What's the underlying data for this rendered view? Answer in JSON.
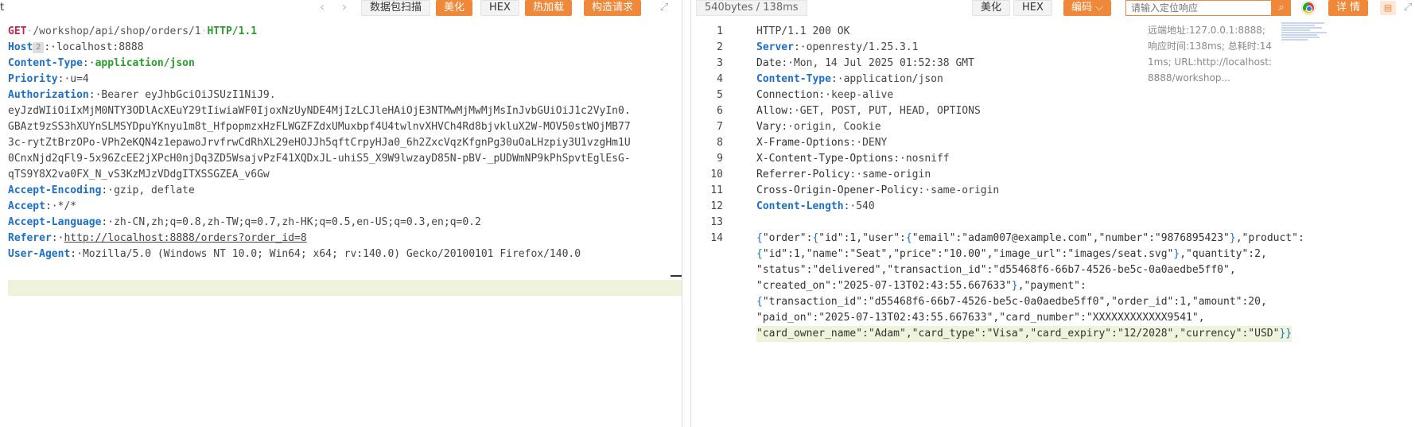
{
  "left_toolbar": {
    "title": "t",
    "back_arrow": "‹",
    "forward_arrow": "›",
    "buttons": {
      "scan": "数据包扫描",
      "beautify": "美化",
      "hex": "HEX",
      "hot_load": "热加载",
      "build_request": "构造请求"
    },
    "expand_glyph": "⤢"
  },
  "request": {
    "method": "GET",
    "path": "/workshop/api/shop/orders/1",
    "protocol": "HTTP/1.1",
    "host_key": "Host",
    "host_badge": "2",
    "host_value": "localhost:8888",
    "headers": [
      {
        "key": "Content-Type",
        "value": "application/json",
        "style": "green"
      },
      {
        "key": "Priority",
        "value": "u=4",
        "style": "plain"
      },
      {
        "key": "Authorization",
        "value": "Bearer eyJhbGciOiJSUzI1NiJ9.",
        "style": "plain"
      }
    ],
    "token_lines": [
      "eyJzdWIiOiIxMjM0NTY3ODlAcXEuY29tIiwiaWF0IjoxNzUyNDE4MjIzLCJleHAiOjE3NTMwMjMwMjMsInJvbGUiOiJ1c2VyIn0.",
      "GBAzt9zSS3hXUYnSLMSYDpuYKnyu1m8t_HfpopmzxHzFLWGZFZdxUMuxbpf4U4twlnvXHVCh4Rd8bjvkluX2W-MOV50stWOjMB77",
      "3c-rytZtBrzOPo-VPh2eKQN4z1epawoJrvfrwCdRhXL29eHOJJh5qftCrpyHJa0_6h2ZxcVqzKfgnPg30uOaLHzpiy3U1vzgHm1U",
      "0CnxNjd2qFl9-5x96ZcEE2jXPcH0njDq3ZD5WsajvPzF41XQDxJL-uhiS5_X9W9lwzayD85N-pBV-_pUDWmNP9kPhSpvtEglEsG-",
      "qTS9Y8X2va0FX_N_vS3KzMJzVDdgITXSSGZEA_v6Gw"
    ],
    "headers_after": [
      {
        "key": "Accept-Encoding",
        "value": "gzip, deflate",
        "style": "plain"
      },
      {
        "key": "Accept",
        "value": "*/*",
        "style": "plain"
      },
      {
        "key": "Accept-Language",
        "value": "zh-CN,zh;q=0.8,zh-TW;q=0.7,zh-HK;q=0.5,en-US;q=0.3,en;q=0.2",
        "style": "plain"
      },
      {
        "key": "Referer",
        "value": "http://localhost:8888/orders?order_id=8",
        "style": "link"
      },
      {
        "key": "User-Agent",
        "value": "Mozilla/5.0 (Windows NT 10.0; Win64; x64; rv:140.0) Gecko/20100101 Firefox/140.0",
        "style": "plain"
      }
    ]
  },
  "right_toolbar": {
    "size_label": "540bytes / 138ms",
    "beautify": "美化",
    "hex": "HEX",
    "encoding": "编码",
    "encoding_caret": "⌵",
    "search_placeholder": "请输入定位响应",
    "search_glyph": "⌕",
    "details": "详 情",
    "chat_glyph": "▤",
    "expand_glyph": "⤢"
  },
  "response": {
    "status_line": "HTTP/1.1 200 OK",
    "headers": [
      {
        "key": "Server",
        "value": "openresty/1.25.3.1",
        "style": "blue"
      },
      {
        "key": "Date",
        "value": "Mon, 14 Jul 2025 01:52:38 GMT",
        "style": "plain"
      },
      {
        "key": "Content-Type",
        "value": "application/json",
        "style": "blue"
      },
      {
        "key": "Connection",
        "value": "keep-alive",
        "style": "plain"
      },
      {
        "key": "Allow",
        "value": "GET, POST, PUT, HEAD, OPTIONS",
        "style": "plain"
      },
      {
        "key": "Vary",
        "value": "origin, Cookie",
        "style": "plain"
      },
      {
        "key": "X-Frame-Options",
        "value": "DENY",
        "style": "plain"
      },
      {
        "key": "X-Content-Type-Options",
        "value": "nosniff",
        "style": "plain"
      },
      {
        "key": "Referrer-Policy",
        "value": "same-origin",
        "style": "plain"
      },
      {
        "key": "Cross-Origin-Opener-Policy",
        "value": "same-origin",
        "style": "plain"
      },
      {
        "key": "Content-Length",
        "value": "540",
        "style": "blue"
      }
    ],
    "body_lines": [
      "{\"order\":{\"id\":1,\"user\":{\"email\":\"adam007@example.com\",\"number\":\"9876895423\"},\"product\":",
      "{\"id\":1,\"name\":\"Seat\",\"price\":\"10.00\",\"image_url\":\"images/seat.svg\"},\"quantity\":2,",
      "\"status\":\"delivered\",\"transaction_id\":\"d55468f6-66b7-4526-be5c-0a0aedbe5ff0\",",
      "\"created_on\":\"2025-07-13T02:43:55.667633\"},\"payment\":",
      "{\"transaction_id\":\"d55468f6-66b7-4526-be5c-0a0aedbe5ff0\",\"order_id\":1,\"amount\":20,",
      "\"paid_on\":\"2025-07-13T02:43:55.667633\",\"card_number\":\"XXXXXXXXXXXX9541\",",
      "\"card_owner_name\":\"Adam\",\"card_type\":\"Visa\",\"card_expiry\":\"12/2028\",\"currency\":\"USD\"}}"
    ],
    "info": "远端地址:127.0.0.1:8888; 响应时间:138ms; 总耗时:141ms; URL:http://localhost:8888/workshop..."
  }
}
